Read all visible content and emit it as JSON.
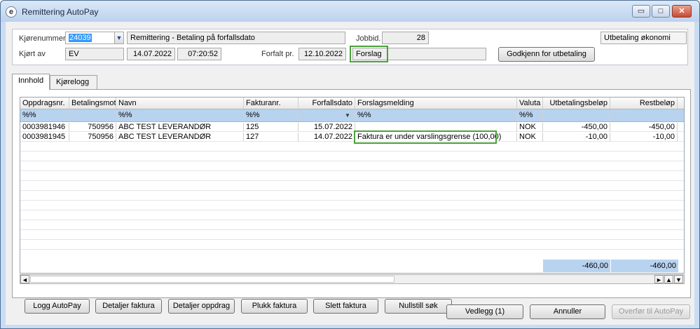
{
  "window": {
    "title": "Remittering AutoPay",
    "controls": {
      "minimize": "▭",
      "maximize": "□",
      "close": "✕"
    }
  },
  "header": {
    "run_number_label": "Kjørenummer",
    "run_number_value": "24039",
    "run_description": "Remittering - Betaling på forfallsdato",
    "job_id_label": "Jobbid.",
    "job_id_value": "28",
    "department": "Utbetaling økonomi",
    "run_by_label": "Kjørt av",
    "run_by_value": "EV",
    "run_date": "14.07.2022",
    "run_time": "07:20:52",
    "due_label": "Forfalt pr.",
    "due_value": "12.10.2022",
    "status": "Forslag",
    "approve_button": "Godkjenn for utbetaling"
  },
  "tabs": [
    {
      "label": "Innhold",
      "active": true
    },
    {
      "label": "Kjørelogg",
      "active": false
    }
  ],
  "grid": {
    "columns": [
      "Oppdragsnr.",
      "Betalingsmott",
      "Navn",
      "Fakturanr.",
      "Forfallsdato",
      "Forslagsmelding",
      "Valuta",
      "Utbetalingsbeløp",
      "Restbeløp"
    ],
    "filters": [
      "%%",
      "",
      "%%",
      "%%",
      "",
      "%%",
      "%%",
      "",
      ""
    ],
    "rows": [
      [
        "0003981946",
        "750956",
        "ABC TEST LEVERANDØR",
        "125",
        "15.07.2022",
        "",
        "NOK",
        "-450,00",
        "-450,00"
      ],
      [
        "0003981945",
        "750956",
        "ABC TEST LEVERANDØR",
        "127",
        "14.07.2022",
        "Faktura er under varslingsgrense (100,00)",
        "NOK",
        "-10,00",
        "-10,00"
      ]
    ],
    "totals": {
      "utbetaling": "-460,00",
      "rest": "-460,00"
    }
  },
  "actions": {
    "logg": "Logg AutoPay",
    "detaljer_faktura": "Detaljer faktura",
    "detaljer_oppdrag": "Detaljer oppdrag",
    "plukk": "Plukk faktura",
    "slett": "Slett faktura",
    "nullstill": "Nullstill søk"
  },
  "footer": {
    "vedlegg": "Vedlegg (1)",
    "annuller": "Annuller",
    "overfor": "Overfør til AutoPay"
  },
  "icons": {
    "dropdown": "▼",
    "left": "◄",
    "right": "►",
    "up": "▲",
    "down": "▼"
  },
  "colors": {
    "highlight_border": "#4aa23a",
    "filter_row": "#b8d3f0",
    "selection": "#3399ff"
  }
}
